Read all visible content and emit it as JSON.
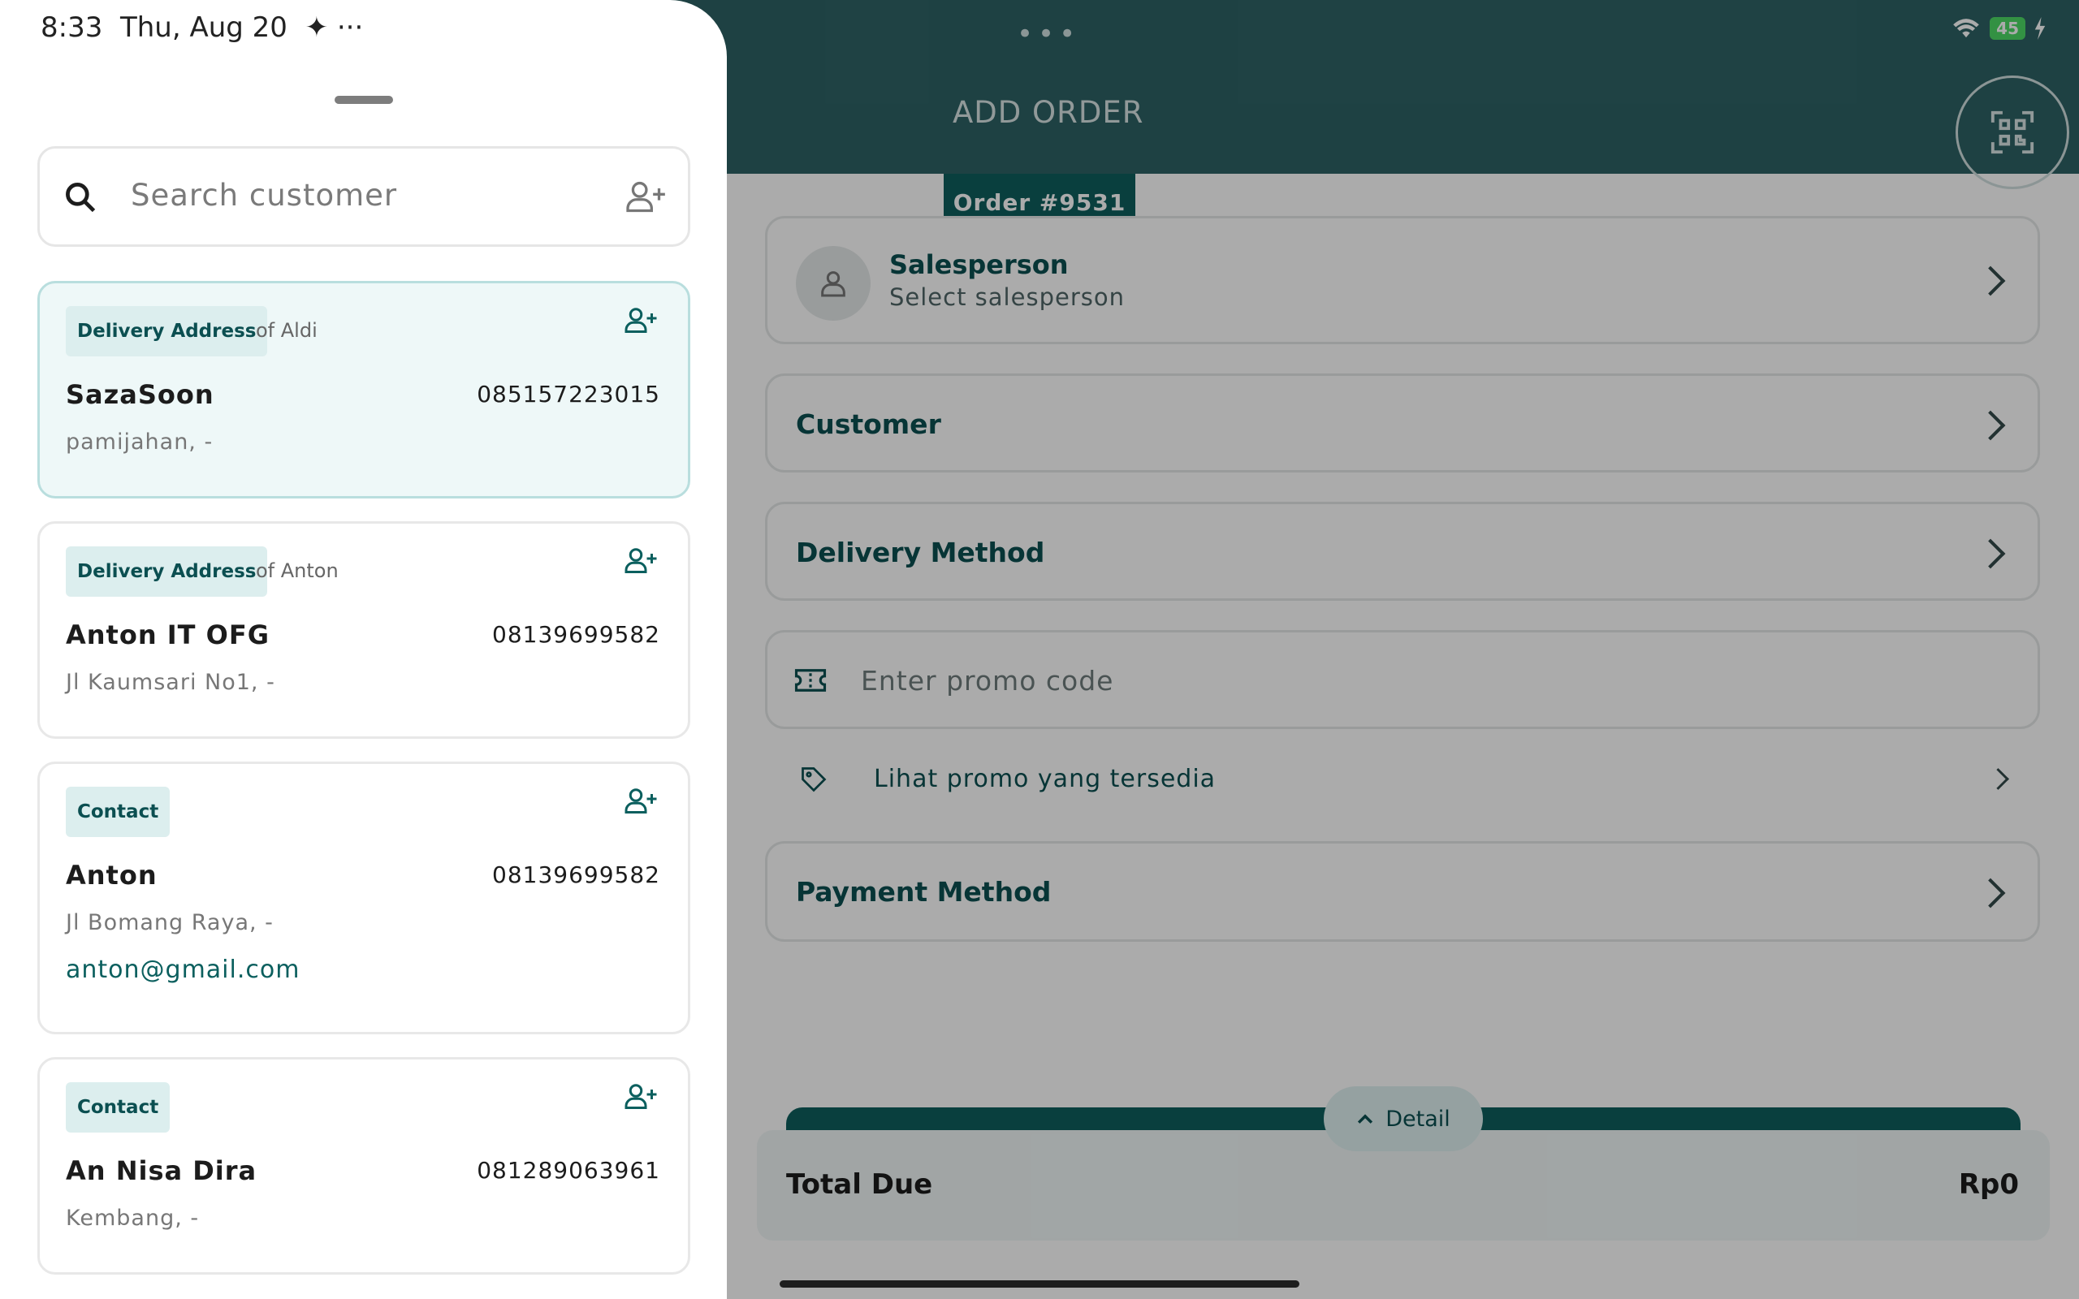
{
  "status_bar": {
    "time": "8:33",
    "date": "Thu, Aug 20",
    "battery": "45"
  },
  "header": {
    "title": "ADD ORDER"
  },
  "order": {
    "label": "Order #9531"
  },
  "salesperson": {
    "title": "Salesperson",
    "subtitle": "Select salesperson"
  },
  "customer": {
    "label": "Customer"
  },
  "delivery": {
    "label": "Delivery Method"
  },
  "promo": {
    "placeholder": "Enter promo code",
    "link": "Lihat promo yang tersedia"
  },
  "payment": {
    "label": "Payment Method"
  },
  "footer": {
    "detail": "Detail",
    "total_label": "Total Due",
    "total_value": "Rp0"
  },
  "sheet": {
    "search_placeholder": "Search customer",
    "customers": [
      {
        "badge": "Delivery Address",
        "of": "of Aldi",
        "name": "SazaSoon",
        "phone": "085157223015",
        "address": "pamijahan, -"
      },
      {
        "badge": "Delivery Address",
        "of": "of Anton",
        "name": "Anton IT OFG",
        "phone": "08139699582",
        "address": "Jl Kaumsari No1, -"
      },
      {
        "badge": "Contact",
        "name": "Anton",
        "phone": "08139699582",
        "address": "Jl Bomang Raya, -",
        "email": "anton@gmail.com"
      },
      {
        "badge": "Contact",
        "name": "An Nisa Dira",
        "phone": "081289063961",
        "address": "Kembang, -"
      }
    ]
  }
}
